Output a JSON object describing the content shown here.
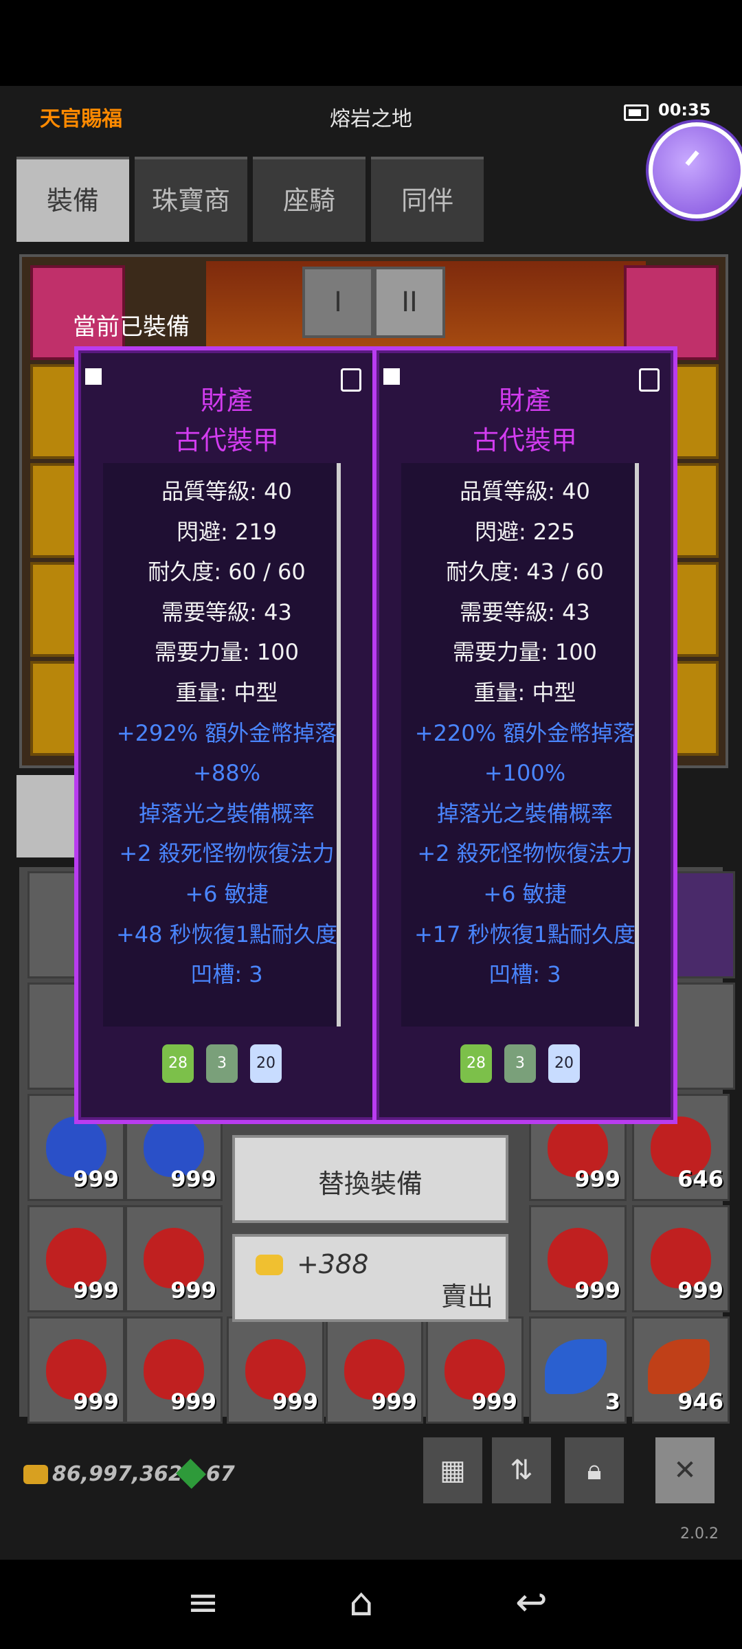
{
  "header": {
    "left_title": "天官賜福",
    "center_title": "熔岩之地",
    "time": "00:35"
  },
  "tabs": [
    {
      "label": "裝備"
    },
    {
      "label": "珠寶商"
    },
    {
      "label": "座騎"
    },
    {
      "label": "同伴"
    }
  ],
  "equip_pages": [
    "I",
    "II"
  ],
  "equipped_label": "當前已裝備",
  "compare": [
    {
      "category": "財產",
      "name": "古代裝甲",
      "stats": [
        "品質等級: 40",
        "閃避: 219",
        "耐久度: 60 / 60",
        "需要等級: 43",
        "需要力量: 100",
        "重量: 中型"
      ],
      "bonuses": [
        "+292% 額外金幣掉落",
        "+88%",
        "掉落光之裝備概率",
        "+2 殺死怪物恢復法力",
        "+6 敏捷",
        "+48 秒恢復1點耐久度",
        "凹槽: 3"
      ],
      "sockets": [
        "28",
        "3",
        "20"
      ]
    },
    {
      "category": "財產",
      "name": "古代裝甲",
      "stats": [
        "品質等級: 40",
        "閃避: 225",
        "耐久度: 43 / 60",
        "需要等級: 43",
        "需要力量: 100",
        "重量: 中型"
      ],
      "bonuses": [
        "+220% 額外金幣掉落",
        "+100%",
        "掉落光之裝備概率",
        "+2 殺死怪物恢復法力",
        "+6 敏捷",
        "+17 秒恢復1點耐久度",
        "凹槽: 3"
      ],
      "sockets": [
        "28",
        "3",
        "20"
      ]
    }
  ],
  "actions": {
    "replace_label": "替換裝備",
    "sell_price": "+388",
    "sell_label": "賣出"
  },
  "inventory_counts": [
    "999",
    "999",
    "999",
    "999",
    "646",
    "999",
    "999",
    "999",
    "999",
    "999",
    "999",
    "999",
    "999",
    "999",
    "3",
    "946"
  ],
  "status": {
    "gold": "86,997,362",
    "gems": "67"
  },
  "version": "2.0.2",
  "colors": {
    "accent_orange": "#ff8a00",
    "panel_border": "#b93cf0",
    "title_magenta": "#d33cf0",
    "bonus_blue": "#4a86ff"
  }
}
